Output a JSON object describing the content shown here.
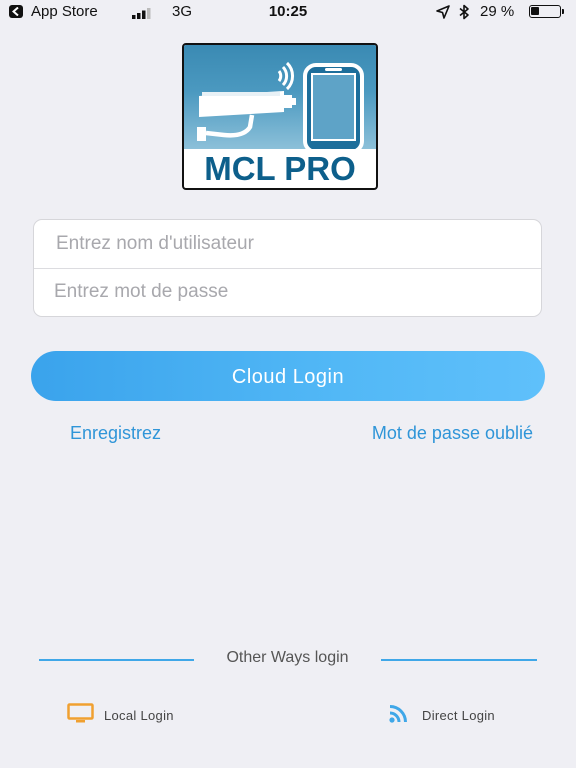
{
  "status_bar": {
    "carrier": "App Store",
    "network": "3G",
    "time": "10:25",
    "battery_percent": "29 %"
  },
  "logo": {
    "text": "MCL PRO"
  },
  "login_form": {
    "username_placeholder": "Entrez nom d'utilisateur",
    "password_placeholder": "Entrez mot de passe"
  },
  "cloud_login_label": "Cloud Login",
  "links": {
    "register": "Enregistrez",
    "forgot_password": "Mot de passe oublié"
  },
  "other_ways": {
    "title": "Other Ways login",
    "local_login": "Local Login",
    "direct_login": "Direct Login"
  },
  "colors": {
    "accent": "#3fa7e8",
    "link": "#2f95d8",
    "local_icon": "#f0a030",
    "direct_icon": "#3fa7e8",
    "logo_text": "#0d5f8b"
  },
  "icons": {
    "back": "back-arrow-icon",
    "signal": "signal-bars-icon",
    "location": "location-arrow-icon",
    "bluetooth": "bluetooth-icon",
    "battery": "battery-icon",
    "local": "monitor-icon",
    "direct": "wifi-icon"
  }
}
